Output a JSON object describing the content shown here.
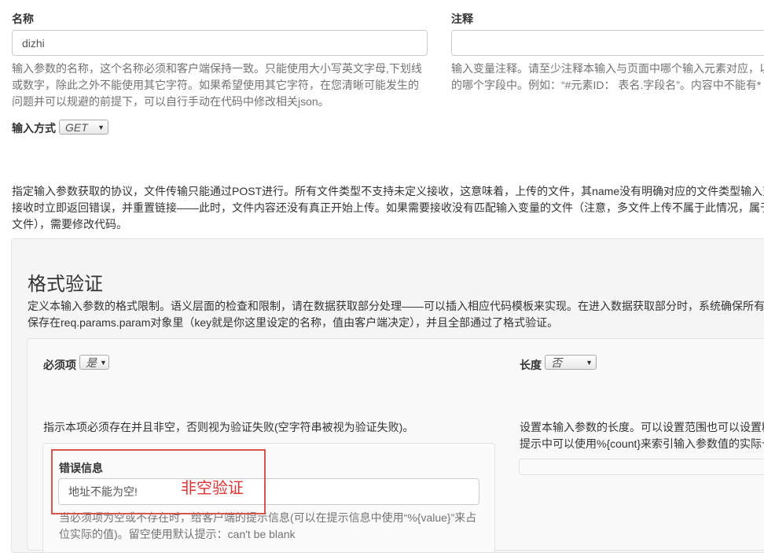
{
  "name_field": {
    "label": "名称",
    "value": "dizhi",
    "help_lines": [
      "输入参数的名称，这个名称必须和客户端保持一致。只能使用大小写英文字母,下划线",
      "或数字，除此之外不能使用其它字符。如果希望使用其它字符，在您清晰可能发生的",
      "问题并可以规避的前提下，可以自行手动在代码中修改相关json。"
    ]
  },
  "comment_field": {
    "label": "注释",
    "value": "",
    "help_lines": [
      "输入变量注释。请至少注释本输入与页面中哪个输入元素对应，以",
      "的哪个字段中。例如：“#元素ID： 表名.字段名”。内容中不能有*"
    ]
  },
  "input_method": {
    "label": "输入方式",
    "selected": "GET",
    "help_lines": [
      "指定输入参数获取的协议，文件传输只能通过POST进行。所有文件类型不支持未定义接收，这意味着，上传的文件，其name没有明确对应的文件类型输入变",
      "接收时立即返回错误，并重置链接——此时，文件内容还没有真正开始上传。如果需要接收没有匹配输入变量的文件（注意，多文件上传不属于此情况，属于",
      "文件），需要修改代码。"
    ]
  },
  "format_section": {
    "title": "格式验证",
    "desc_lines": [
      "定义本输入参数的格式限制。语义层面的检查和限制，请在数据获取部分处理——可以插入相应代码模板来实现。在进入数据获取部分时，系统确保所有",
      "保存在req.params.param对象里（key就是你这里设定的名称，值由客户端决定），并且全部通过了格式验证。"
    ]
  },
  "required": {
    "label": "必须项",
    "selected": "是",
    "help": "指示本项必须存在并且非空，否则视为验证失败(空字符串被视为验证失败)。"
  },
  "length": {
    "label": "长度",
    "selected": "否",
    "help_lines": [
      "设置本输入参数的长度。可以设置范围也可以设置精",
      "提示中可以使用%{count}来索引输入参数值的实际长"
    ]
  },
  "error_message": {
    "label": "错误信息",
    "value": "地址不能为空!",
    "help_lines": [
      "当必须项为空或不存在时，给客户端的提示信息(可以在提示信息中使用“%{value}”来占",
      "位实际的值)。留空使用默认提示：can't be blank"
    ]
  },
  "annotation": {
    "text": "非空验证",
    "color": "#e03333"
  }
}
